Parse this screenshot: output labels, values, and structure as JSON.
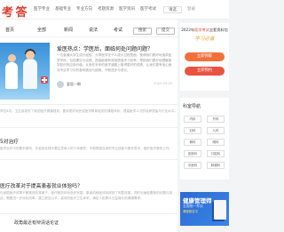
{
  "header": {
    "logo": "考 答",
    "nav": [
      "医学专业",
      "基础专业",
      "专业方向",
      "考题资源",
      "医学资讯",
      "医学考试"
    ],
    "select_label": "请选",
    "login": "登录"
  },
  "tabs": {
    "items": [
      "首页",
      "全部",
      "新闻",
      "说法",
      "考试"
    ],
    "btn1": "搜索",
    "btn2": "提交"
  },
  "hero": {
    "title": "爱医热点：学医后，面临何处问题问题？",
    "text": "一位普通大学生成长经验，分享医学在个人成长过程里面，使得我们更好地追求医学学科，包括理论与实践，提高能够有效地提高学习效率，帮助我们更好地理解医学知识的应用价值，从而在未来的医学道路上取得更好的成绩，让我们更有信心面对专业学习中的各种挑战与困难，不断进步与成长。",
    "author": "爱医一瞬",
    "date": "2022-04-25"
  },
  "snippet1": "早在8月，卫生部发布了新的医疗健康规划，要求更好地完成医学教育相关的课程体系，提高医学人才的培养质量与行业水平。",
  "section1": {
    "title": "5对治疗",
    "text": "医学治疗中的基本原则，在临床实践中要注意病人的个体差异，不断提高自身的专业技能与服务意识，做好医疗服务工作。"
  },
  "section2": {
    "title": "医疗改革对于提高患者就业体验吗？",
    "text": "在我国医疗改革不断推进的背景下，医疗服务体系逐步完善，患者的就医体验得到了明显改善，同时也面临着新的问题与挑战，需要进一步深化改革，建立更加公平、高效的医疗卫生体系，满足人民群众日益增长的健康需求。"
  },
  "bottom": {
    "title": "政角最近有辩清话论证"
  },
  "sidebar": {
    "promo_line_prefix": "2022年",
    "promo_line_red": "医学考试",
    "promo_line_suffix": "全套资料包",
    "promo_sub": "学习必备",
    "btn1": "立即领取",
    "btn2": "立即预约",
    "nav_title": "科室导航",
    "nav_items": [
      "内科",
      "外科",
      "妇科",
      "儿科",
      "骨科",
      "眼科",
      "皮肤科",
      "口腔科",
      "中医科",
      "肿瘤科"
    ],
    "ad_title": "健康管理师",
    "ad_sub": "全国统一考试",
    "ad_sub2": "课程报名中"
  },
  "colors": {
    "brand": "#e23a2e",
    "accent": "#f2703a",
    "ad_bg": "#2b6ad3"
  }
}
